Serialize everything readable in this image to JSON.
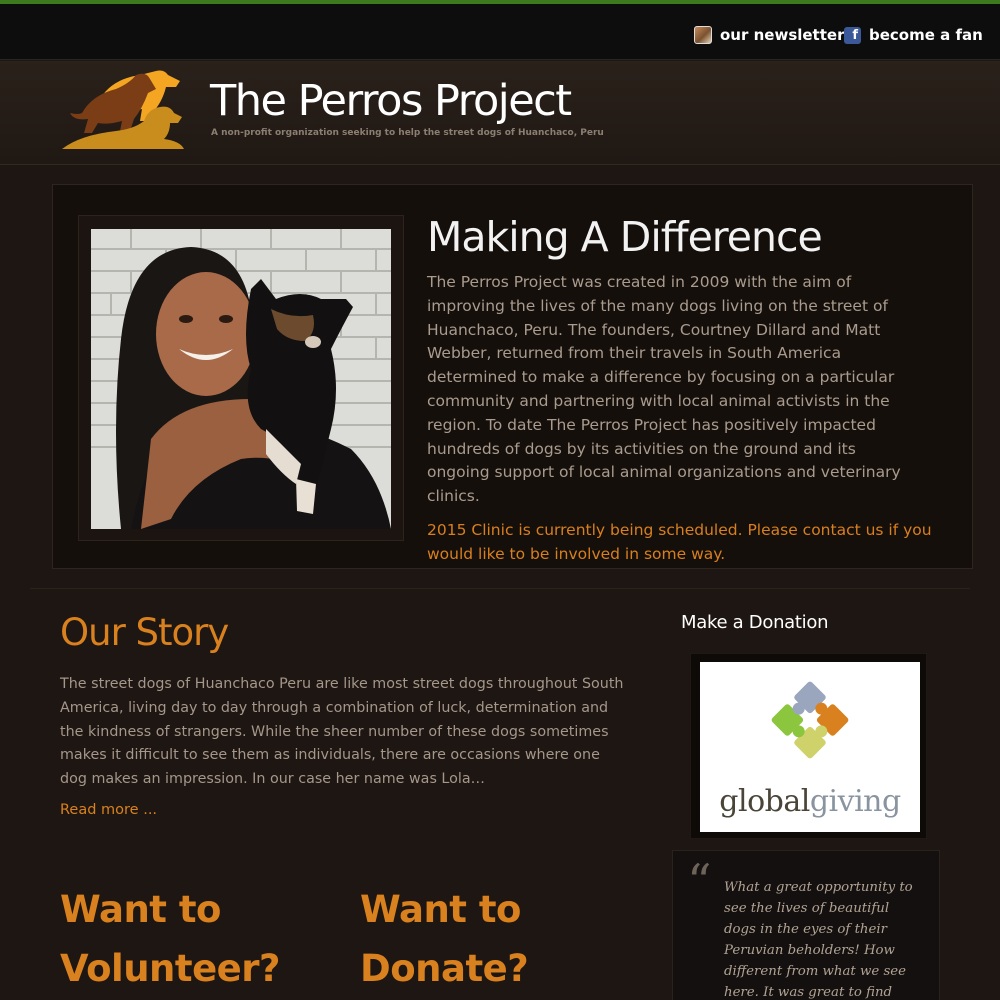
{
  "colors": {
    "accent": "#d9811e",
    "topline": "#3d7a1e",
    "background": "#1e1612"
  },
  "topbar": {
    "newsletter_label": "our newsletter",
    "fan_label": "become a fan",
    "newsletter_icon": "avatar-icon",
    "fan_icon": "facebook-icon"
  },
  "header": {
    "title": "The Perros Project",
    "tagline": "A non-profit organization seeking to help the street dogs of Huanchaco, Peru",
    "logo_icon": "dogs-logo"
  },
  "feature": {
    "title": "Making A Difference",
    "body": "The Perros Project was created in 2009 with the aim of improving the lives of the many dogs living on the street of Huanchaco, Peru. The founders, Courtney Dillard and Matt Webber, returned from their travels in South America determined to make a difference by focusing on a particular community and partnering with local animal activists in the region. To date The Perros Project has positively impacted hundreds of dogs by its activities on the ground and its ongoing support of local animal organizations and veterinary clinics.",
    "note": "2015 Clinic is currently being scheduled. Please contact us if you would like to be involved in some way."
  },
  "story": {
    "title": "Our Story",
    "body": "The street dogs of Huanchaco Peru are like most street dogs throughout South America, living day to day through a combination of luck, determination and the kindness of strangers. While the sheer number of these dogs sometimes makes it difficult to see them as individuals, there are occasions where one dog makes an impression. In our case her name was Lola…",
    "read_more": "Read more ..."
  },
  "cta": {
    "volunteer": "Want to Volunteer?",
    "donate": "Want to Donate?"
  },
  "sidebar": {
    "donation_heading": "Make a Donation",
    "globalgiving_part1": "global",
    "globalgiving_part2": "giving",
    "quote_mark": "“",
    "quote": "What a great opportunity to see the lives of beautiful dogs in the eyes of their Peruvian beholders! How different from what we see here. It was great to find"
  }
}
